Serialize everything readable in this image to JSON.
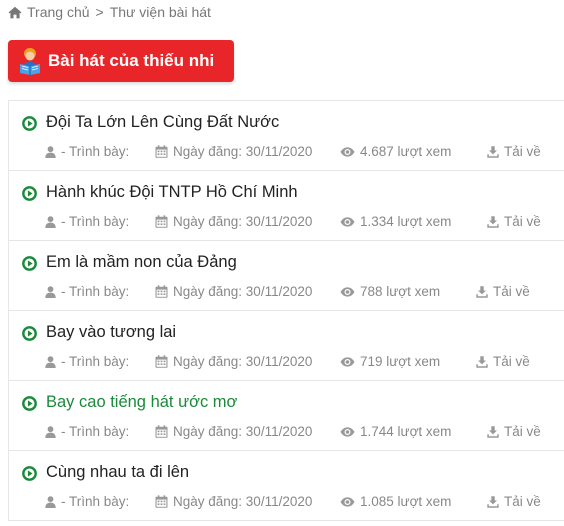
{
  "breadcrumb": {
    "home_label": "Trang chủ",
    "separator": ">",
    "current_label": "Thư viện bài hát"
  },
  "section": {
    "title": "Bài hát của thiếu nhi"
  },
  "colors": {
    "accent_red": "#e8262a",
    "play_green": "#1a8a3a",
    "meta_gray": "#888888"
  },
  "icons": {
    "home": "home-icon",
    "reader": "child-reading-icon",
    "play": "play-circle-icon",
    "user": "user-icon",
    "calendar": "calendar-icon",
    "views": "eye-icon",
    "download": "download-icon"
  },
  "songs": [
    {
      "title": "Đội Ta Lớn Lên Cùng Đất Nước",
      "performer": "- Trình bày:",
      "date": "Ngày đăng: 30/11/2020",
      "views": "4.687 lượt xem",
      "download": "Tải về"
    },
    {
      "title": "Hành khúc Đội TNTP Hồ Chí Minh",
      "performer": "- Trình bày:",
      "date": "Ngày đăng: 30/11/2020",
      "views": "1.334 lượt xem",
      "download": "Tải về"
    },
    {
      "title": "Em là mầm non của Đảng",
      "performer": "- Trình bày:",
      "date": "Ngày đăng: 30/11/2020",
      "views": "788 lượt xem",
      "download": "Tải về"
    },
    {
      "title": "Bay vào tương lai",
      "performer": "- Trình bày:",
      "date": "Ngày đăng: 30/11/2020",
      "views": "719 lượt xem",
      "download": "Tải về"
    },
    {
      "title": "Bay cao tiếng hát ước mơ",
      "performer": "- Trình bày:",
      "date": "Ngày đăng: 30/11/2020",
      "views": "1.744 lượt xem",
      "download": "Tải về"
    },
    {
      "title": "Cùng nhau ta đi lên",
      "performer": "- Trình bày:",
      "date": "Ngày đăng: 30/11/2020",
      "views": "1.085 lượt xem",
      "download": "Tải về"
    }
  ]
}
